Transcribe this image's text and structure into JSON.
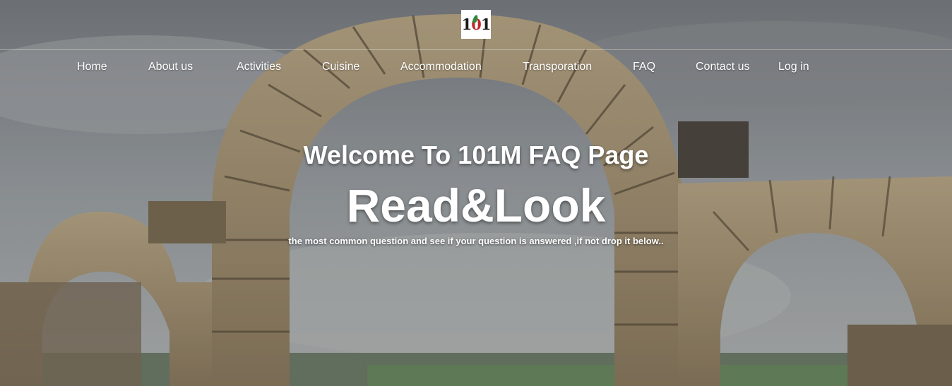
{
  "logo": {
    "text_left": "1",
    "text_o": "0",
    "text_right": "1"
  },
  "nav": {
    "items": [
      {
        "label": "Home"
      },
      {
        "label": "About us"
      },
      {
        "label": "Activities"
      },
      {
        "label": "Cuisine"
      },
      {
        "label": "Accommodation"
      },
      {
        "label": "Transporation"
      },
      {
        "label": "FAQ"
      },
      {
        "label": "Contact us"
      },
      {
        "label": "Log in"
      }
    ]
  },
  "hero": {
    "headline": "Welcome To 101M FAQ Page",
    "title": "Read&Look",
    "subtitle": "the most common question and see if your question is answered ,if not drop it below.."
  },
  "colors": {
    "text": "#ffffff",
    "logo_red": "#c0282d",
    "logo_green": "#2e8b3d"
  }
}
